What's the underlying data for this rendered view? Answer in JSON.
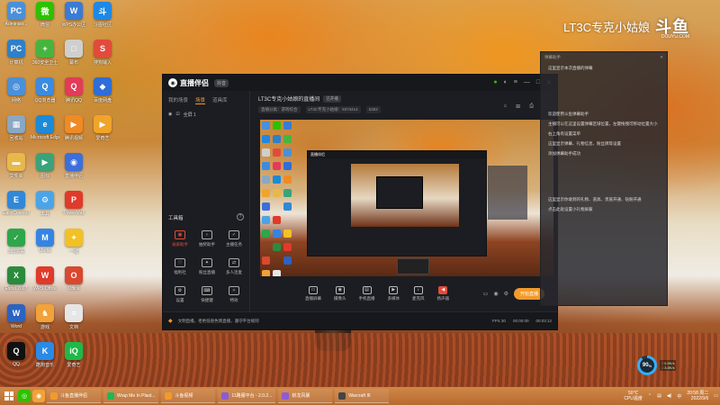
{
  "desktop": {
    "icons": [
      {
        "label": "Administr...",
        "color": "#4a90d9",
        "glyph": "PC"
      },
      {
        "label": "微信",
        "color": "#2dc100",
        "glyph": "微"
      },
      {
        "label": "WPS办公区",
        "color": "#3a7bd5",
        "glyph": "W"
      },
      {
        "label": "斗图社区",
        "color": "#1e88e5",
        "glyph": "斗"
      },
      {
        "label": "计算机",
        "color": "#2f80c8",
        "glyph": "PC"
      },
      {
        "label": "360安全卫士",
        "color": "#46b53f",
        "glyph": "+"
      },
      {
        "label": "幕布",
        "color": "#cfcfcf",
        "glyph": "□"
      },
      {
        "label": "搜狗输入",
        "color": "#e24b3c",
        "glyph": "S"
      },
      {
        "label": "网络",
        "color": "#4a90d9",
        "glyph": "◎"
      },
      {
        "label": "QQ浏览器",
        "color": "#3b8be0",
        "glyph": "Q"
      },
      {
        "label": "腾讯QQ",
        "color": "#e33b5a",
        "glyph": "Q"
      },
      {
        "label": "百度网盘",
        "color": "#2e6ed6",
        "glyph": "◆"
      },
      {
        "label": "回收站",
        "color": "#8aa7c4",
        "glyph": "▦"
      },
      {
        "label": "Microsoft Edge",
        "color": "#1b8ad9",
        "glyph": "e"
      },
      {
        "label": "腾讯视频",
        "color": "#f08a24",
        "glyph": "▶"
      },
      {
        "label": "爱奇艺",
        "color": "#f1a42a",
        "glyph": "▶"
      },
      {
        "label": "文件夹",
        "color": "#e8b84a",
        "glyph": "▬"
      },
      {
        "label": "图标",
        "color": "#3aa37a",
        "glyph": "▶"
      },
      {
        "label": "直播伴侣",
        "color": "#3c6fdc",
        "glyph": "◉"
      },
      {
        "label": "",
        "color": "transparent",
        "glyph": ""
      },
      {
        "label": "EasyConnect",
        "color": "#2f88d8",
        "glyph": "E"
      },
      {
        "label": "工具",
        "color": "#4aa4e8",
        "glyph": "⚙"
      },
      {
        "label": "PowerMall",
        "color": "#e03a2a",
        "glyph": "P"
      },
      {
        "label": "",
        "color": "transparent",
        "glyph": ""
      },
      {
        "label": "360杀毒",
        "color": "#2ea64a",
        "glyph": "✓"
      },
      {
        "label": "Media",
        "color": "#3584e4",
        "glyph": "M"
      },
      {
        "label": "一键",
        "color": "#f2c124",
        "glyph": "✦"
      },
      {
        "label": "",
        "color": "transparent",
        "glyph": ""
      },
      {
        "label": "Excel 2007",
        "color": "#2a8b3c",
        "glyph": "X"
      },
      {
        "label": "WPS Office",
        "color": "#e03a2a",
        "glyph": "W"
      },
      {
        "label": "Office",
        "color": "#d9482f",
        "glyph": "O"
      },
      {
        "label": "",
        "color": "transparent",
        "glyph": ""
      },
      {
        "label": "Word",
        "color": "#2b63c2",
        "glyph": "W"
      },
      {
        "label": "游戏",
        "color": "#f1a238",
        "glyph": "♞"
      },
      {
        "label": "文档",
        "color": "#e6e6e6",
        "glyph": "≡"
      },
      {
        "label": "",
        "color": "transparent",
        "glyph": ""
      },
      {
        "label": "QQ",
        "color": "#111111",
        "glyph": "Q"
      },
      {
        "label": "酷狗音乐",
        "color": "#2a8ae5",
        "glyph": "K"
      },
      {
        "label": "爱奇艺",
        "color": "#1fb848",
        "glyph": "iQ"
      },
      {
        "label": "",
        "color": "transparent",
        "glyph": ""
      }
    ]
  },
  "watermark": {
    "text": "LT3C专克小姑娘",
    "logo": "斗鱼",
    "sub": "DOUYU.COM"
  },
  "app": {
    "name": "直播伴侣",
    "version": "抖音",
    "left_tabs": [
      "我的场景",
      "场景",
      "道具库"
    ],
    "active_tab": "场景",
    "scene_row": [
      "全屏 1"
    ],
    "tools_title": "工具箱",
    "tools": [
      {
        "label": "录屏助手",
        "glyph": "▣",
        "red": true
      },
      {
        "label": "抽奖助手",
        "glyph": "♀",
        "red": false
      },
      {
        "label": "主播任务",
        "glyph": "✓",
        "red": false
      },
      {
        "label": "福利社",
        "glyph": "♡",
        "red": false
      },
      {
        "label": "粉丝直播",
        "glyph": "✦",
        "red": false
      },
      {
        "label": "多人连麦",
        "glyph": "⇄",
        "red": false
      },
      {
        "label": "设置",
        "glyph": "⚙",
        "red": false
      },
      {
        "label": "快捷键",
        "glyph": "⌨",
        "red": false
      },
      {
        "label": "特效",
        "glyph": "✧",
        "red": false
      }
    ],
    "room": {
      "title": "LT3C专克小姑娘的直播间",
      "tag": "已开播",
      "meta": [
        "直播分类：游戏综合",
        "LT3C专克小姑娘：9373414",
        "5302"
      ]
    },
    "controls": [
      {
        "label": "直播屏幕",
        "glyph": "▭",
        "red": false
      },
      {
        "label": "摄像头",
        "glyph": "◉",
        "red": false
      },
      {
        "label": "手机直播",
        "glyph": "▤",
        "red": false
      },
      {
        "label": "多媒体",
        "glyph": "▶",
        "red": false
      },
      {
        "label": "麦克风",
        "glyph": "♪",
        "red": false
      },
      {
        "label": "扬声器",
        "glyph": "◀",
        "red": true
      }
    ],
    "go_live": "开始直播",
    "status": {
      "notice": "文明直播，拒绝低俗色情直播，遵守平台规则",
      "fps": "FPS 30",
      "time_a": "00:00:00",
      "time_b": "00:03:12"
    }
  },
  "chat": {
    "header": "弹幕助手",
    "messages": [
      "这里显示本次直播的弹幕",
      "欢迎使用斗鱼弹幕助手",
      "主播可以在这里设置弹幕区域位置，左键拖拽可移动位置大小",
      "右上角有设置菜单",
      "这里显示弹幕、礼物信息、粉丝牌等设置",
      "添加弹幕助手成功",
      "这里显示你收到的礼物、道具、贵族开通、钻粉开通",
      "点击此处设置小礼物屏蔽"
    ]
  },
  "perf": {
    "percent": "90",
    "unit": "%",
    "line1": "↑ 0.6K/s",
    "line2": "↓ 3.8K/s"
  },
  "taskbar": {
    "tasks": [
      {
        "label": "斗鱼直播伴侣",
        "color": "#f39a2b"
      },
      {
        "label": "Wrap Me In Plast...",
        "color": "#1db954"
      },
      {
        "label": "斗鱼视频",
        "color": "#f39a2b"
      },
      {
        "label": "11路服平台 - 2.0.2...",
        "color": "#8e5bd6"
      },
      {
        "label": "斩龙风暴",
        "color": "#8e5bd6"
      },
      {
        "label": "Warcraft III",
        "color": "#444444"
      }
    ],
    "cpu": "50℃",
    "cpu_label": "CPU温度",
    "time": "20:58 周二",
    "date": "2022/9/6"
  }
}
